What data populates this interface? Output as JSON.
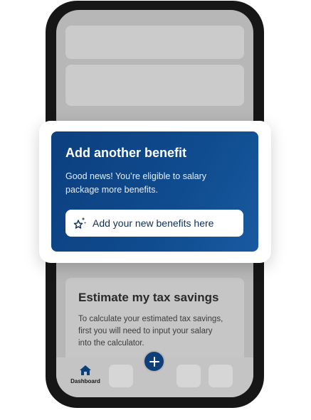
{
  "benefit_card": {
    "title": "Add another benefit",
    "body_line_1": "Good news! You’re eligible to salary",
    "body_line_2": "package more benefits.",
    "button_label": "Add your new benefits here",
    "button_icon": "sparkle-star-icon"
  },
  "tax_card": {
    "title": "Estimate my tax savings",
    "body_line_1": "To calculate your estimated tax savings,",
    "body_line_2": "first you will need to input your salary",
    "body_line_3": "into the calculator."
  },
  "bottom_nav": {
    "home_label": "Dashboard",
    "home_icon": "home-icon",
    "fab_icon": "plus-icon"
  },
  "colors": {
    "brand_blue": "#0f3f78",
    "phone_frame": "#161616",
    "skeleton_gray": "#cbcbcb"
  }
}
